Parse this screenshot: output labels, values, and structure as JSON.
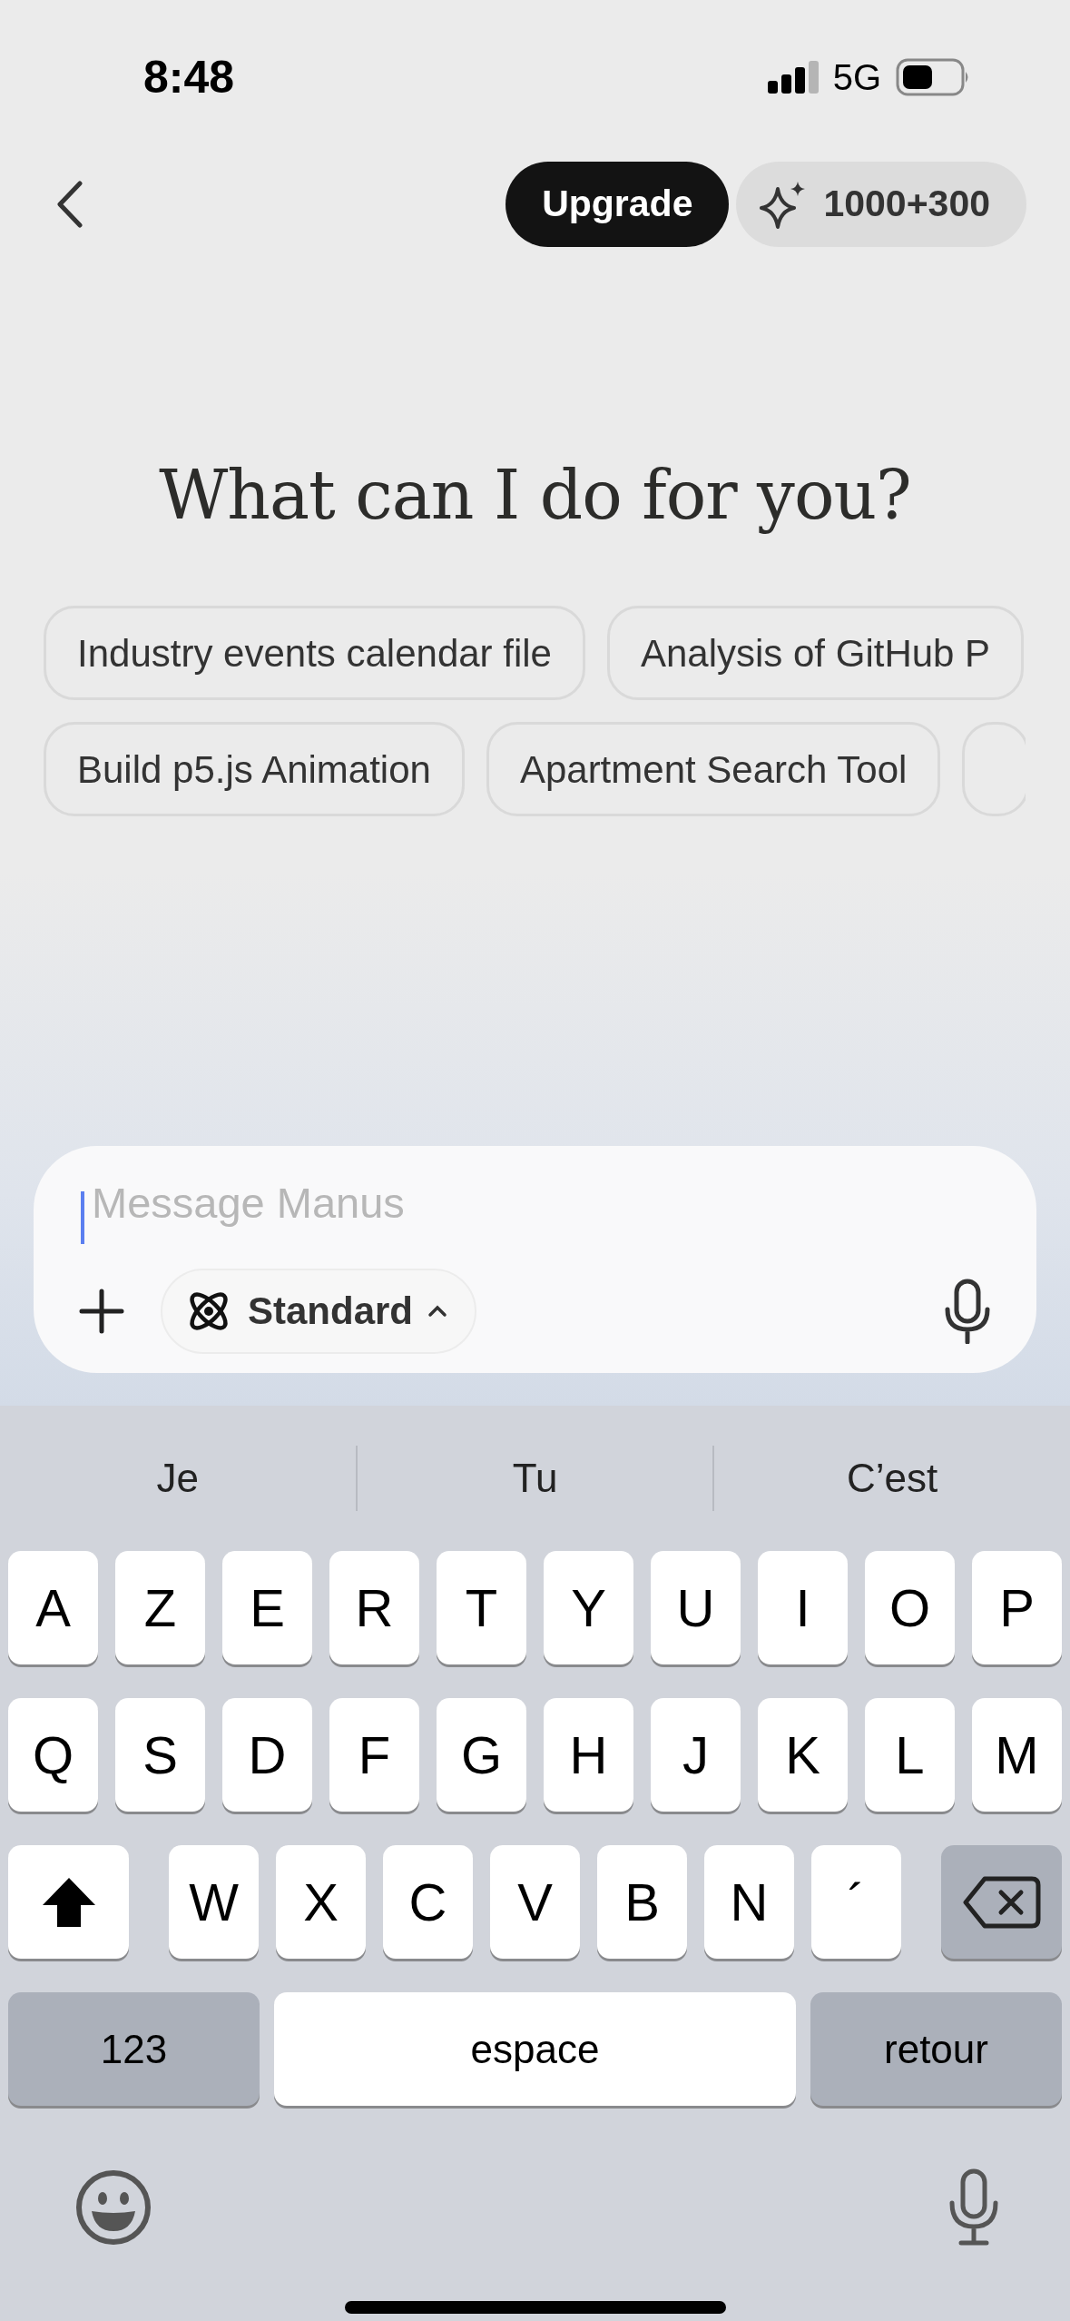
{
  "status_bar": {
    "time": "8:48",
    "network": "5G"
  },
  "top_bar": {
    "upgrade": "Upgrade",
    "credits": "1000+300"
  },
  "title": "What can I do for you?",
  "suggestions": [
    [
      {
        "kind": "suggestion",
        "label": "Industry events calendar file"
      },
      {
        "kind": "suggestion",
        "label": "Analysis of GitHub P"
      }
    ],
    [
      {
        "kind": "suggestion",
        "label": "Build p5.js Animation"
      },
      {
        "kind": "suggestion",
        "label": "Apartment Search Tool"
      },
      {
        "kind": "partial"
      }
    ]
  ],
  "composer": {
    "placeholder": "Message Manus",
    "mode": "Standard"
  },
  "keyboard": {
    "predictions": [
      "Je",
      "Tu",
      "C’est"
    ],
    "rows": [
      [
        {
          "kind": "letter",
          "label": "A"
        },
        {
          "kind": "letter",
          "label": "Z"
        },
        {
          "kind": "letter",
          "label": "E"
        },
        {
          "kind": "letter",
          "label": "R"
        },
        {
          "kind": "letter",
          "label": "T"
        },
        {
          "kind": "letter",
          "label": "Y"
        },
        {
          "kind": "letter",
          "label": "U"
        },
        {
          "kind": "letter",
          "label": "I"
        },
        {
          "kind": "letter",
          "label": "O"
        },
        {
          "kind": "letter",
          "label": "P"
        }
      ],
      [
        {
          "kind": "letter",
          "label": "Q"
        },
        {
          "kind": "letter",
          "label": "S"
        },
        {
          "kind": "letter",
          "label": "D"
        },
        {
          "kind": "letter",
          "label": "F"
        },
        {
          "kind": "letter",
          "label": "G"
        },
        {
          "kind": "letter",
          "label": "H"
        },
        {
          "kind": "letter",
          "label": "J"
        },
        {
          "kind": "letter",
          "label": "K"
        },
        {
          "kind": "letter",
          "label": "L"
        },
        {
          "kind": "letter",
          "label": "M"
        }
      ],
      [
        {
          "kind": "shift"
        },
        {
          "kind": "letter",
          "label": "W"
        },
        {
          "kind": "letter",
          "label": "X"
        },
        {
          "kind": "letter",
          "label": "C"
        },
        {
          "kind": "letter",
          "label": "V"
        },
        {
          "kind": "letter",
          "label": "B"
        },
        {
          "kind": "letter",
          "label": "N"
        },
        {
          "kind": "letter",
          "label": "´"
        },
        {
          "kind": "backspace"
        }
      ]
    ],
    "bottom_row": [
      {
        "kind": "numbers",
        "label": "123"
      },
      {
        "kind": "space",
        "label": "espace"
      },
      {
        "kind": "return",
        "label": "retour"
      }
    ]
  }
}
